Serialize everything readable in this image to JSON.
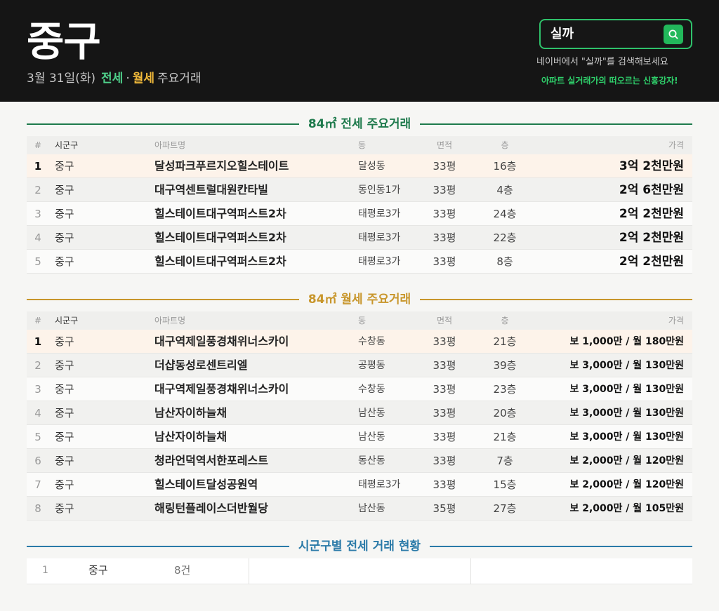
{
  "header": {
    "region": "중구",
    "date": "3월 31일(화)",
    "jeonse_label": "전세",
    "separator": "·",
    "wolse_label": "월세",
    "suffix": "주요거래"
  },
  "search": {
    "query": "실까",
    "hint": "네이버에서 \"실까\"를 검색해보세요",
    "promo": "아파트 실거래가의 떠오르는 신흥강자!"
  },
  "columns": {
    "num": "#",
    "gu": "시군구",
    "apt": "아파트명",
    "dong": "동",
    "area": "면적",
    "floor": "층",
    "price": "가격"
  },
  "jeonse": {
    "title": "84㎡ 전세 주요거래",
    "rows": [
      {
        "num": "1",
        "gu": "중구",
        "apt": "달성파크푸르지오힐스테이트",
        "dong": "달성동",
        "area": "33평",
        "floor": "16층",
        "price": "3억 2천만원"
      },
      {
        "num": "2",
        "gu": "중구",
        "apt": "대구역센트럴대원칸타빌",
        "dong": "동인동1가",
        "area": "33평",
        "floor": "4층",
        "price": "2억 6천만원"
      },
      {
        "num": "3",
        "gu": "중구",
        "apt": "힐스테이트대구역퍼스트2차",
        "dong": "태평로3가",
        "area": "33평",
        "floor": "24층",
        "price": "2억 2천만원"
      },
      {
        "num": "4",
        "gu": "중구",
        "apt": "힐스테이트대구역퍼스트2차",
        "dong": "태평로3가",
        "area": "33평",
        "floor": "22층",
        "price": "2억 2천만원"
      },
      {
        "num": "5",
        "gu": "중구",
        "apt": "힐스테이트대구역퍼스트2차",
        "dong": "태평로3가",
        "area": "33평",
        "floor": "8층",
        "price": "2억 2천만원"
      }
    ]
  },
  "wolse": {
    "title": "84㎡ 월세 주요거래",
    "rows": [
      {
        "num": "1",
        "gu": "중구",
        "apt": "대구역제일풍경채위너스카이",
        "dong": "수창동",
        "area": "33평",
        "floor": "21층",
        "price": "보 1,000만 / 월 180만원"
      },
      {
        "num": "2",
        "gu": "중구",
        "apt": "더샵동성로센트리엘",
        "dong": "공평동",
        "area": "33평",
        "floor": "39층",
        "price": "보 3,000만 / 월 130만원"
      },
      {
        "num": "3",
        "gu": "중구",
        "apt": "대구역제일풍경채위너스카이",
        "dong": "수창동",
        "area": "33평",
        "floor": "23층",
        "price": "보 3,000만 / 월 130만원"
      },
      {
        "num": "4",
        "gu": "중구",
        "apt": "남산자이하늘채",
        "dong": "남산동",
        "area": "33평",
        "floor": "20층",
        "price": "보 3,000만 / 월 130만원"
      },
      {
        "num": "5",
        "gu": "중구",
        "apt": "남산자이하늘채",
        "dong": "남산동",
        "area": "33평",
        "floor": "21층",
        "price": "보 3,000만 / 월 130만원"
      },
      {
        "num": "6",
        "gu": "중구",
        "apt": "청라언덕역서한포레스트",
        "dong": "동산동",
        "area": "33평",
        "floor": "7층",
        "price": "보 2,000만 / 월 120만원"
      },
      {
        "num": "7",
        "gu": "중구",
        "apt": "힐스테이트달성공원역",
        "dong": "태평로3가",
        "area": "33평",
        "floor": "15층",
        "price": "보 2,000만 / 월 120만원"
      },
      {
        "num": "8",
        "gu": "중구",
        "apt": "해링턴플레이스더반월당",
        "dong": "남산동",
        "area": "35평",
        "floor": "27층",
        "price": "보 2,000만 / 월 105만원"
      }
    ]
  },
  "summary": {
    "title": "시군구별 전세 거래 현황",
    "items": [
      {
        "num": "1",
        "gu": "중구",
        "count": "8건"
      }
    ]
  },
  "colors": {
    "header_bg": "#151515",
    "jeonse_accent": "#1e7a4c",
    "wolse_accent": "#c8962b",
    "summary_accent": "#2a7aa8",
    "search_accent": "#22b85b"
  }
}
